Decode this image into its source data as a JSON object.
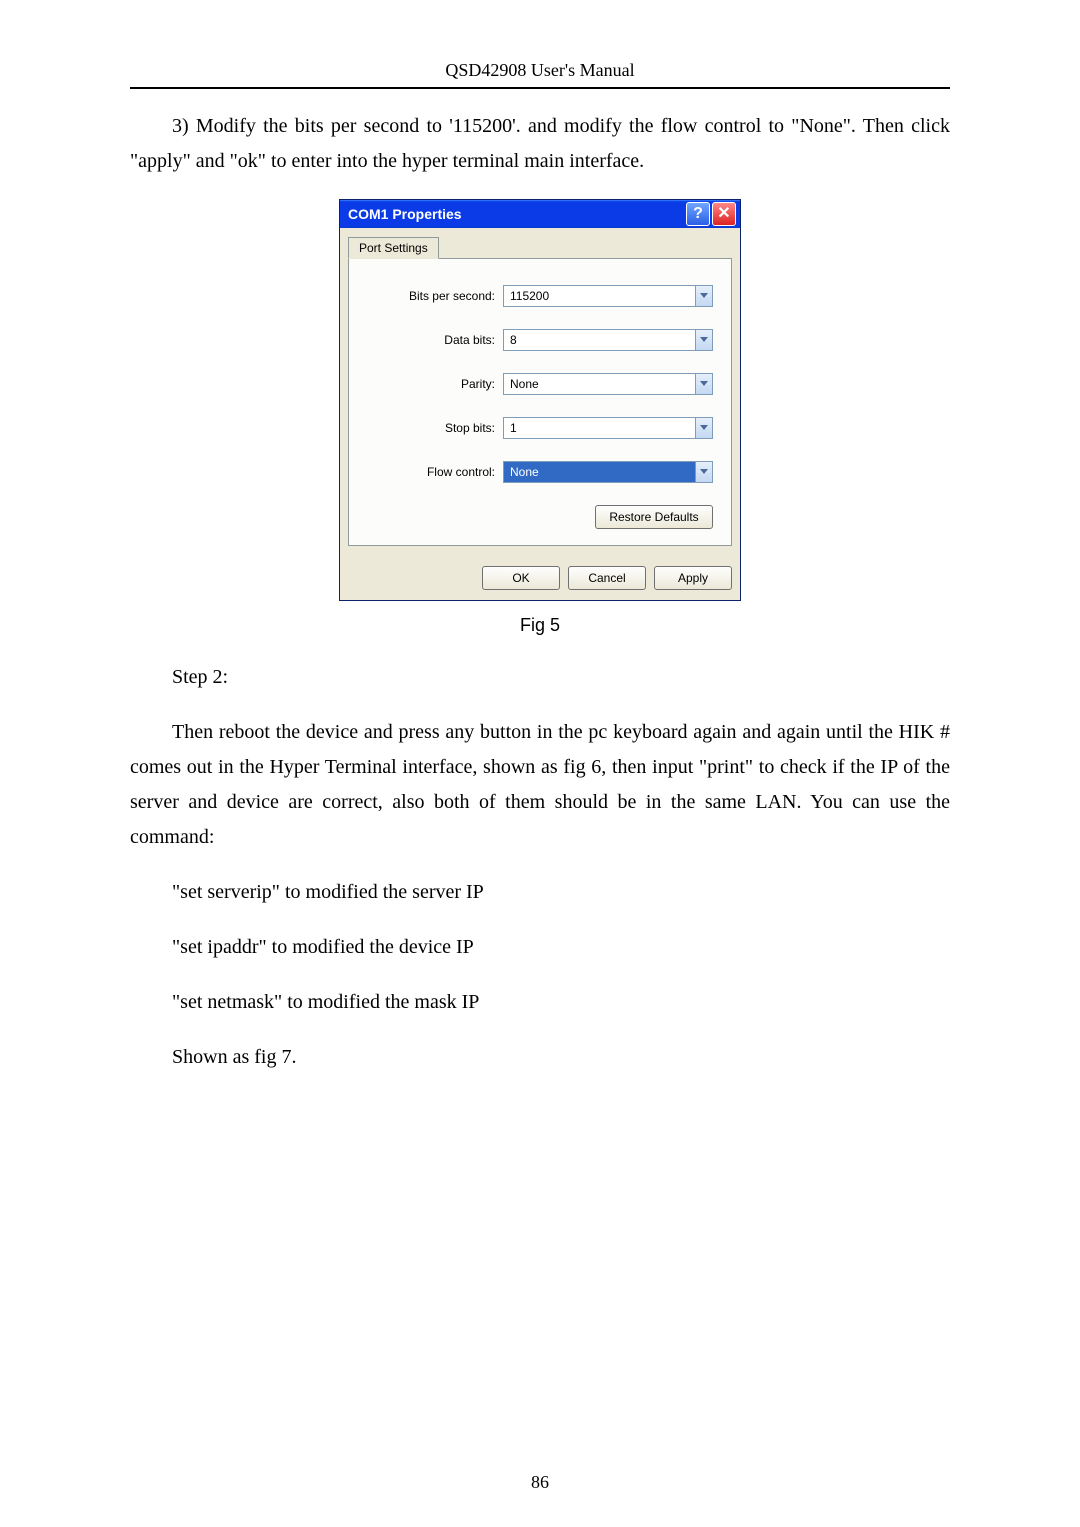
{
  "header": "QSD42908 User's Manual",
  "para1": "3) Modify the bits per second to '115200'. and modify the flow control to \"None\". Then click \"apply\" and \"ok\" to enter into the hyper terminal main interface.",
  "dialog": {
    "title": "COM1 Properties",
    "tab": "Port Settings",
    "fields": {
      "bits_per_second": {
        "label": "Bits per second:",
        "value": "115200"
      },
      "data_bits": {
        "label": "Data bits:",
        "value": "8"
      },
      "parity": {
        "label": "Parity:",
        "value": "None"
      },
      "stop_bits": {
        "label": "Stop bits:",
        "value": "1"
      },
      "flow_control": {
        "label": "Flow control:",
        "value": "None"
      }
    },
    "restore": "Restore Defaults",
    "ok": "OK",
    "cancel": "Cancel",
    "apply": "Apply"
  },
  "fig_caption": "Fig 5",
  "step2": "Step 2:",
  "para2": "Then reboot the device and press any button in the pc keyboard again and again until the HIK # comes out in the Hyper Terminal interface, shown as fig 6, then input \"print\" to check if the IP of the server and device are correct, also both of them should be in the same LAN. You can use the command:",
  "cmd1": "\"set serverip\" to modified the server IP",
  "cmd2": "\"set ipaddr\" to modified the device IP",
  "cmd3": "\"set netmask\" to modified the mask IP",
  "cmd4": "Shown as fig 7.",
  "page_number": "86"
}
